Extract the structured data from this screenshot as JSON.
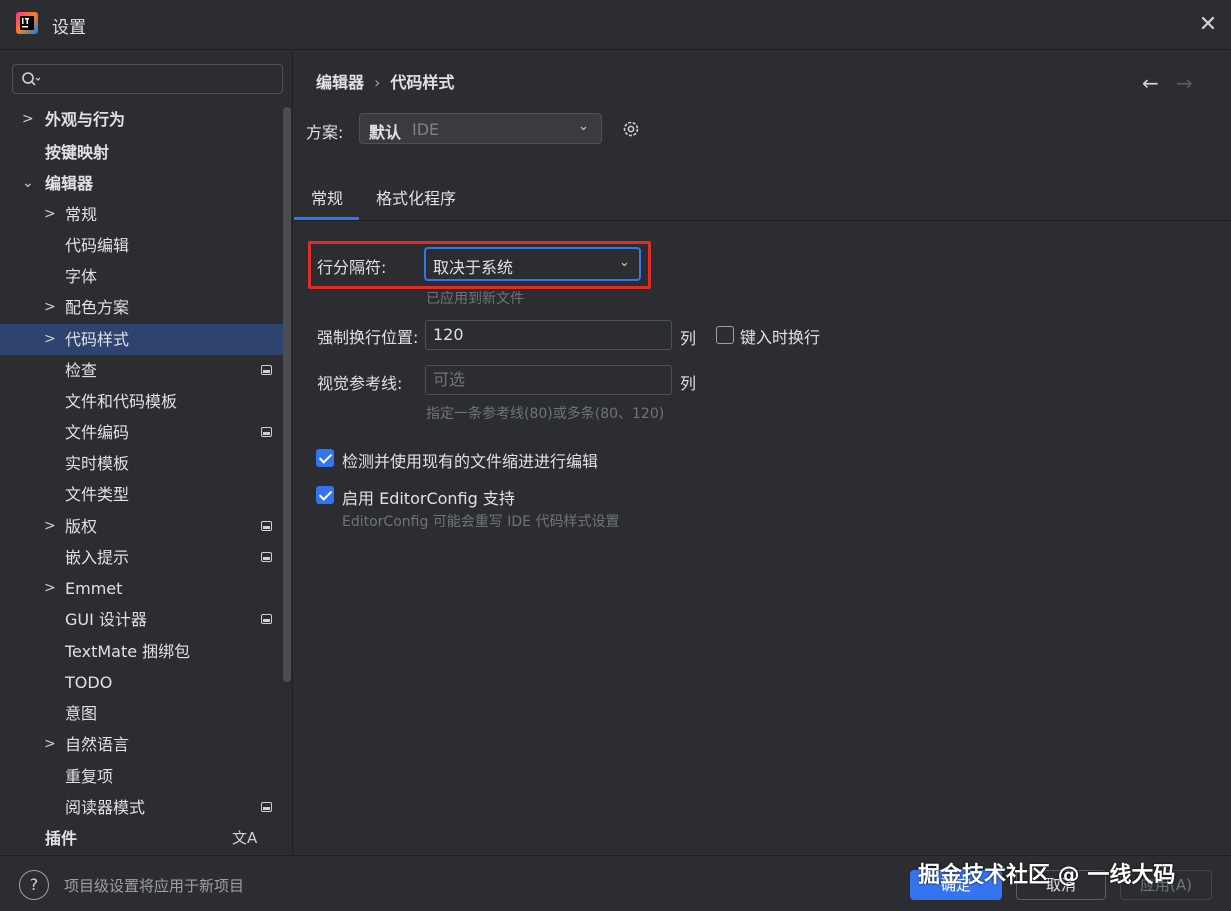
{
  "window": {
    "title": "设置",
    "icon": "intellij-app-icon",
    "close_icon": "close-icon"
  },
  "sidebar": {
    "search": {
      "placeholder": "",
      "icon": "search-icon"
    },
    "items": [
      {
        "label": "外观与行为",
        "level": 0,
        "expandable": true,
        "bold": true,
        "badge": ""
      },
      {
        "label": "按键映射",
        "level": 0,
        "expandable": false,
        "bold": true,
        "badge": ""
      },
      {
        "label": "编辑器",
        "level": 0,
        "expandable": true,
        "expanded": true,
        "bold": true,
        "badge": ""
      },
      {
        "label": "常规",
        "level": 1,
        "expandable": true,
        "badge": ""
      },
      {
        "label": "代码编辑",
        "level": 1,
        "expandable": false,
        "badge": ""
      },
      {
        "label": "字体",
        "level": 1,
        "expandable": false,
        "badge": ""
      },
      {
        "label": "配色方案",
        "level": 1,
        "expandable": true,
        "badge": ""
      },
      {
        "label": "代码样式",
        "level": 1,
        "expandable": true,
        "selected": true,
        "badge": ""
      },
      {
        "label": "检查",
        "level": 1,
        "expandable": false,
        "badge": "project-settings-icon"
      },
      {
        "label": "文件和代码模板",
        "level": 1,
        "expandable": false,
        "badge": ""
      },
      {
        "label": "文件编码",
        "level": 1,
        "expandable": false,
        "badge": "project-settings-icon"
      },
      {
        "label": "实时模板",
        "level": 1,
        "expandable": false,
        "badge": ""
      },
      {
        "label": "文件类型",
        "level": 1,
        "expandable": false,
        "badge": ""
      },
      {
        "label": "版权",
        "level": 1,
        "expandable": true,
        "badge": "project-settings-icon"
      },
      {
        "label": "嵌入提示",
        "level": 1,
        "expandable": false,
        "badge": "project-settings-icon"
      },
      {
        "label": "Emmet",
        "level": 1,
        "expandable": true,
        "badge": ""
      },
      {
        "label": "GUI 设计器",
        "level": 1,
        "expandable": false,
        "badge": "project-settings-icon"
      },
      {
        "label": "TextMate 捆绑包",
        "level": 1,
        "expandable": false,
        "badge": ""
      },
      {
        "label": "TODO",
        "level": 1,
        "expandable": false,
        "badge": ""
      },
      {
        "label": "意图",
        "level": 1,
        "expandable": false,
        "badge": ""
      },
      {
        "label": "自然语言",
        "level": 1,
        "expandable": true,
        "badge": ""
      },
      {
        "label": "重复项",
        "level": 1,
        "expandable": false,
        "badge": ""
      },
      {
        "label": "阅读器模式",
        "level": 1,
        "expandable": false,
        "badge": "project-settings-icon"
      },
      {
        "label": "插件",
        "level": 0,
        "expandable": false,
        "bold": true,
        "badge": "translate-icon"
      }
    ]
  },
  "header": {
    "breadcrumb": [
      "编辑器",
      "代码样式"
    ],
    "breadcrumb_separator": "›",
    "back_icon": "arrow-left-icon",
    "forward_icon": "arrow-right-icon"
  },
  "scheme": {
    "label": "方案:",
    "value": "默认",
    "value_suffix": "IDE",
    "gear_icon": "gear-icon"
  },
  "tabs": [
    {
      "label": "常规",
      "active": true
    },
    {
      "label": "格式化程序",
      "active": false
    }
  ],
  "form": {
    "line_separator": {
      "label": "行分隔符:",
      "value": "取决于系统",
      "hint": "已应用到新文件"
    },
    "hard_wrap": {
      "label": "强制换行位置:",
      "value": "120",
      "unit": "列",
      "wrap_on_typing": {
        "label": "键入时换行",
        "checked": false
      }
    },
    "visual_guides": {
      "label": "视觉参考线:",
      "placeholder": "可选",
      "unit": "列",
      "hint": "指定一条参考线(80)或多条(80、120)"
    },
    "detect_indent": {
      "label": "检测并使用现有的文件缩进进行编辑",
      "checked": true
    },
    "editorconfig": {
      "label": "启用 EditorConfig 支持",
      "checked": true,
      "hint": "EditorConfig 可能会重写 IDE 代码样式设置"
    }
  },
  "footer": {
    "help_icon": "help-icon",
    "help_glyph": "?",
    "hint": "项目级设置将应用于新项目",
    "ok": "确定",
    "cancel": "取消",
    "apply": "应用(A)"
  },
  "watermark": "掘金技术社区 @ 一线大码",
  "colors": {
    "accent": "#3574f0",
    "selection": "#2e436e",
    "highlight_box": "#e02b2b",
    "background": "#2b2d30"
  }
}
